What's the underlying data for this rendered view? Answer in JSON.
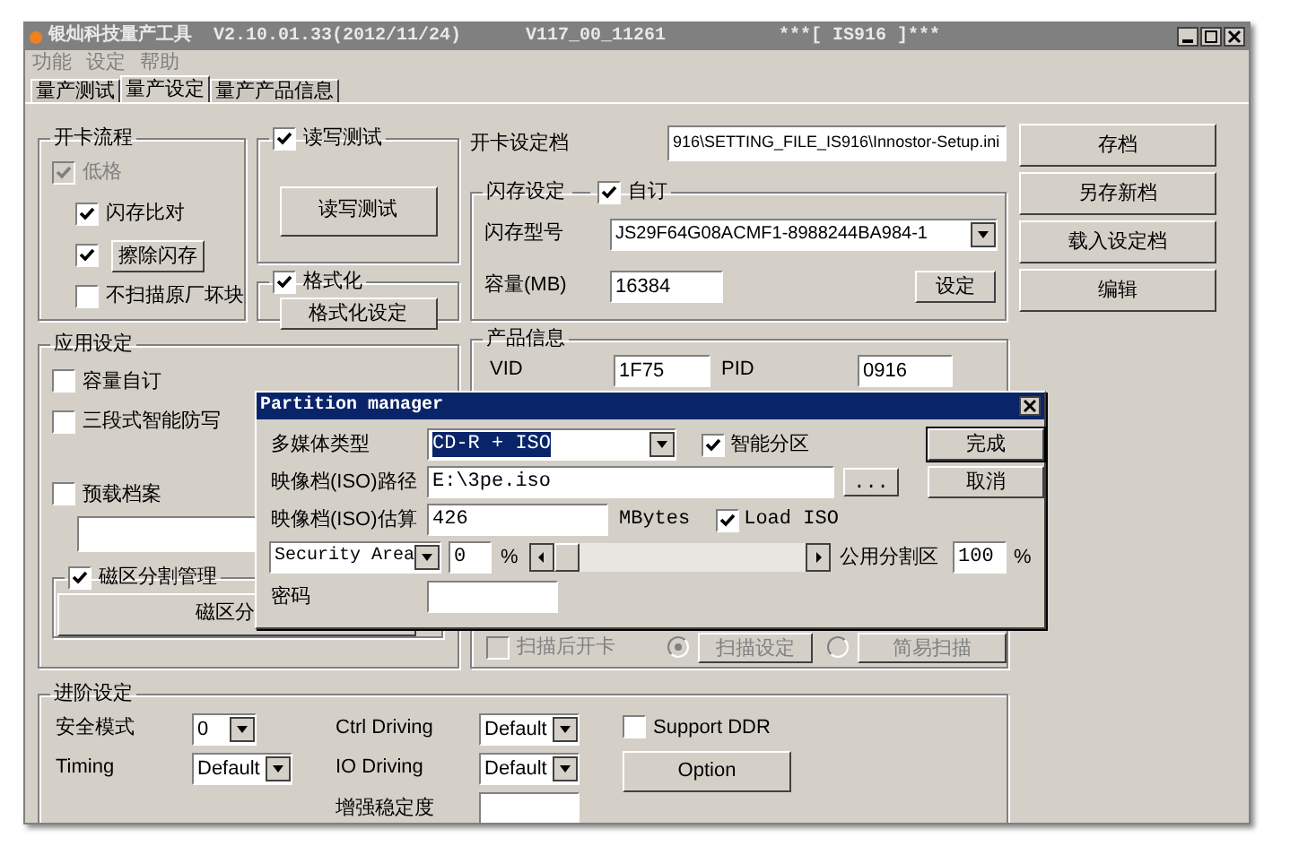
{
  "window": {
    "title": "银灿科技量产工具  V2.10.01.33(2012/11/24)      V117_00_11261",
    "subtitle": "***[ IS916 ]***"
  },
  "menu": [
    "功能",
    "设定",
    "帮助"
  ],
  "tabs": [
    {
      "label": "量产测试",
      "selected": false
    },
    {
      "label": "量产设定",
      "selected": true
    },
    {
      "label": "量产产品信息",
      "selected": false
    }
  ],
  "card_flow": {
    "title": "开卡流程",
    "options": [
      {
        "label": "低格",
        "checked": true,
        "disabled": true,
        "kind": "check"
      },
      {
        "label": "闪存比对",
        "checked": true,
        "disabled": false,
        "kind": "check"
      },
      {
        "label": "擦除闪存",
        "checked": true,
        "disabled": false,
        "kind": "button"
      },
      {
        "label": "不扫描原厂坏块",
        "checked": false,
        "disabled": false,
        "kind": "check"
      }
    ]
  },
  "rw_test": {
    "label": "读写测试",
    "checked": true,
    "button": "读写测试"
  },
  "format": {
    "label": "格式化",
    "checked": true,
    "button": "格式化设定"
  },
  "app_settings": {
    "title": "应用设定",
    "options": [
      {
        "label": "容量自订",
        "checked": false
      },
      {
        "label": "三段式智能防写",
        "checked": false
      },
      {
        "label": "预载档案",
        "checked": false
      }
    ],
    "partition": {
      "label": "磁区分割管理",
      "checked": true,
      "button": "磁区分"
    }
  },
  "setting_file": {
    "label": "开卡设定档",
    "path": "916\\SETTING_FILE_IS916\\Innostor-Setup.ini"
  },
  "flash": {
    "title": "闪存设定",
    "custom": {
      "label": "自订",
      "checked": true
    },
    "model_label": "闪存型号",
    "model": "JS29F64G08ACMF1-8988244BA984-1",
    "capacity_label": "容量(MB)",
    "capacity": "16384",
    "button": "设定"
  },
  "product": {
    "title": "产品信息",
    "vid_label": "VID",
    "vid": "1F75",
    "pid_label": "PID",
    "pid": "0916",
    "scan_open": {
      "label": "扫描后开卡",
      "checked": false,
      "disabled": true
    },
    "scan_modes": [
      {
        "label": "扫描设定",
        "selected": true,
        "disabled": true
      },
      {
        "label": "简易扫描",
        "selected": false,
        "disabled": true
      }
    ]
  },
  "actions": [
    "存档",
    "另存新档",
    "载入设定档",
    "编辑"
  ],
  "advanced": {
    "title": "进阶设定",
    "fields": [
      {
        "label": "安全模式",
        "kind": "select",
        "value": "0"
      },
      {
        "label": "Ctrl Driving",
        "kind": "select",
        "value": "Default"
      },
      {
        "label": "Timing",
        "kind": "select",
        "value": "Default"
      },
      {
        "label": "IO Driving",
        "kind": "select",
        "value": "Default"
      },
      {
        "label": "增强稳定度",
        "kind": "input"
      }
    ],
    "ddr": {
      "label": "Support DDR",
      "checked": false
    },
    "button": "Option"
  },
  "dialog": {
    "title": "Partition manager",
    "media_label": "多媒体类型",
    "media": "CD-R + ISO",
    "smart": {
      "label": "智能分区",
      "checked": true
    },
    "path_label": "映像档(ISO)路径",
    "path": "E:\\3pe.iso",
    "browse": "...",
    "size_label": "映像档(ISO)估算",
    "size": "426",
    "unit": "MBytes",
    "load_iso": {
      "label": "Load ISO",
      "checked": true
    },
    "area": "Security Area",
    "area_value": "0",
    "area_unit": "%",
    "public_label": "公用分割区",
    "public_value": "100",
    "public_unit": "%",
    "password_label": "密码",
    "buttons": [
      "完成",
      "取消"
    ]
  }
}
